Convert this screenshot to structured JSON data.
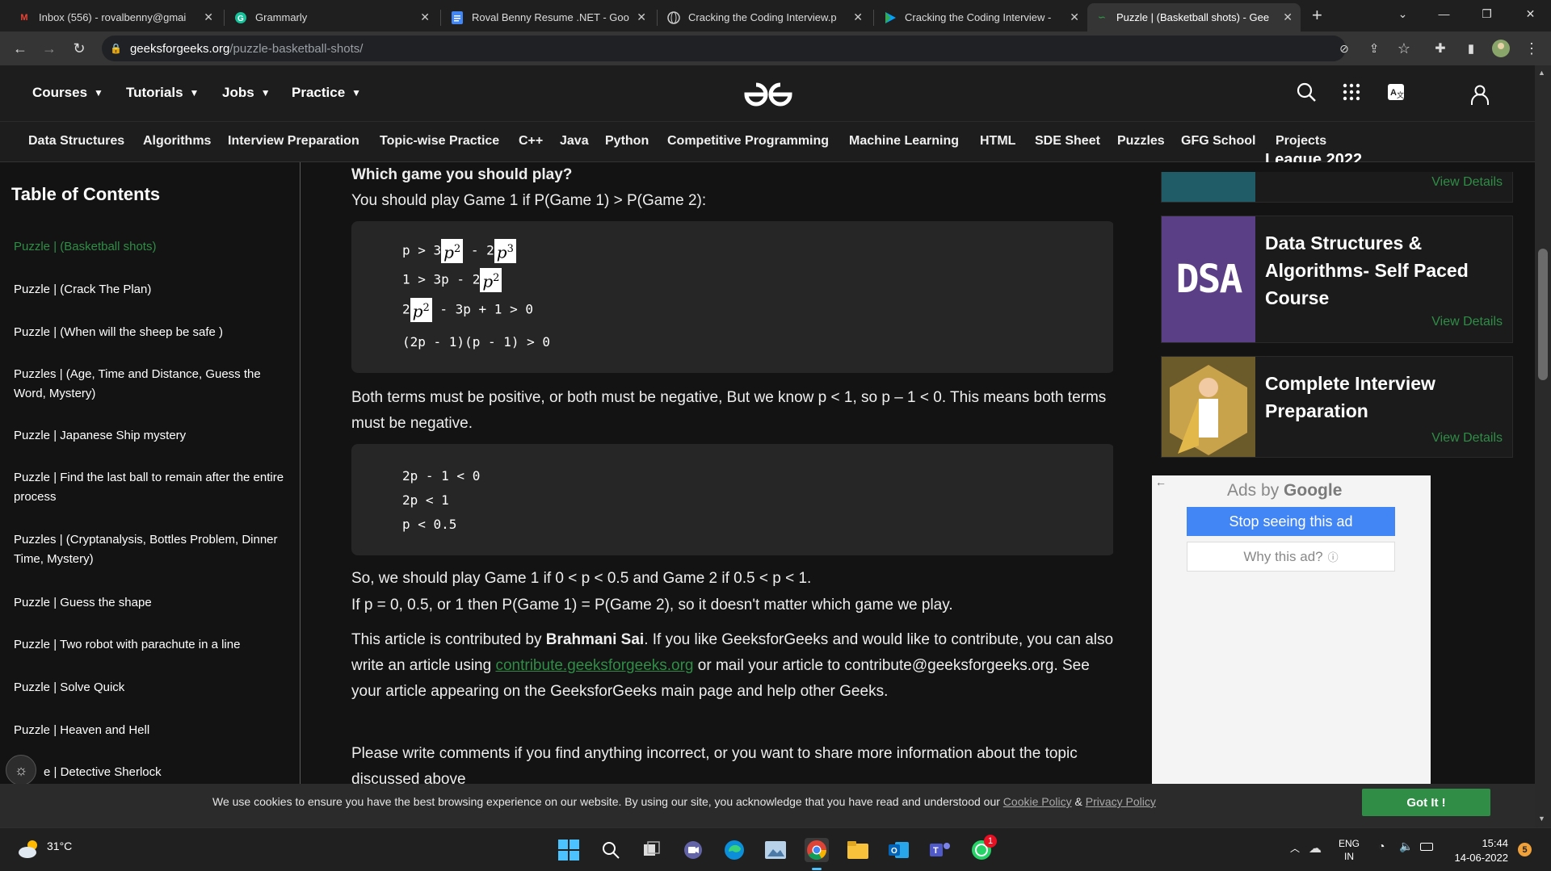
{
  "browser": {
    "tabs": [
      {
        "title": "Inbox (556) - rovalbenny@gmai",
        "icon": "gmail-icon"
      },
      {
        "title": "Grammarly",
        "icon": "grammarly-icon"
      },
      {
        "title": "Roval Benny Resume .NET - Goo",
        "icon": "docs-icon"
      },
      {
        "title": "Cracking the Coding Interview.p",
        "icon": "globe-icon"
      },
      {
        "title": "Cracking the Coding Interview -",
        "icon": "play-icon"
      },
      {
        "title": "Puzzle | (Basketball shots) - Gee",
        "icon": "gfg-icon",
        "active": true
      }
    ],
    "url_host": "geeksforgeeks.org",
    "url_path": "/puzzle-basketball-shots/"
  },
  "header": {
    "menus": [
      "Courses",
      "Tutorials",
      "Jobs",
      "Practice"
    ],
    "subnav": [
      "Data Structures",
      "Algorithms",
      "Interview Preparation",
      "Topic-wise Practice",
      "C++",
      "Java",
      "Python",
      "Competitive Programming",
      "Machine Learning",
      "HTML",
      "SDE Sheet",
      "Puzzles",
      "GFG School",
      "Projects"
    ]
  },
  "toc": {
    "title": "Table of Contents",
    "items": [
      "Puzzle | (Basketball shots)",
      "Puzzle | (Crack The Plan)",
      "Puzzle | (When will the sheep be safe )",
      "Puzzles | (Age, Time and Distance, Guess the Word, Mystery)",
      "Puzzle | Japanese Ship mystery",
      "Puzzle | Find the last ball to remain after the entire process",
      "Puzzles | (Cryptanalysis, Bottles Problem, Dinner Time, Mystery)",
      "Puzzle | Guess the shape",
      "Puzzle | Two robot with parachute in a line",
      "Puzzle | Solve Quick",
      "Puzzle | Heaven and Hell",
      "e | Detective Sherlock"
    ]
  },
  "article": {
    "heading": "Which game you should play?",
    "intro": "You should play Game 1 if P(Game 1) > P(Game 2):",
    "code1": {
      "l1_a": "p > 3",
      "l1_b": "p",
      "l1_e": "2",
      "l1_c": " - 2",
      "l1_d": "p",
      "l1_f": "3",
      "l2_a": "1 > 3p - 2",
      "l2_b": "p",
      "l2_e": "2",
      "l3_a": "2",
      "l3_b": "p",
      "l3_e": "2",
      "l3_c": " - 3p + 1 > 0",
      "l4": "(2p - 1)(p - 1) > 0"
    },
    "para2": "Both terms must be positive, or both must be negative, But we know p < 1, so p – 1 < 0. This means both terms must be negative.",
    "code2": [
      "2p - 1 < 0",
      "2p < 1",
      "p < 0.5"
    ],
    "para3a": "So, we should play Game 1 if 0 < p < 0.5 and Game 2 if 0.5 < p < 1.",
    "para3b": "If p = 0, 0.5, or 1 then P(Game 1) = P(Game 2), so it doesn't matter which game we play.",
    "contrib_1": "This article is contributed by ",
    "contrib_name": "Brahmani Sai",
    "contrib_2": ". If you like GeeksforGeeks and would like to contribute, you can also write an article using ",
    "contrib_link": "contribute.geeksforgeeks.org",
    "contrib_3": " or mail your article to contribute@geeksforgeeks.org. See your article appearing on the GeeksforGeeks main page and help other Geeks.",
    "comments": "Please write comments if you find anything incorrect, or you want to share more information about the topic discussed above"
  },
  "sidebar": {
    "cards": [
      {
        "title": "League 2022",
        "cta": "View Details"
      },
      {
        "title": "Data Structures & Algorithms- Self Paced Course",
        "img_text": "DSA",
        "cta": "View Details"
      },
      {
        "title": "Complete Interview Preparation",
        "cta": "View Details"
      }
    ],
    "ad": {
      "ads_by": "Ads by",
      "google": "Google",
      "stop": "Stop seeing this ad",
      "why": "Why this ad?"
    }
  },
  "cookie": {
    "text": "We use cookies to ensure you have the best browsing experience on our website. By using our site, you acknowledge that you have read and understood our",
    "cookie_policy": "Cookie Policy",
    "amp": "&",
    "privacy_policy": "Privacy Policy",
    "button": "Got It !"
  },
  "taskbar": {
    "weather": "31°C",
    "lang1": "ENG",
    "lang2": "IN",
    "time": "15:44",
    "date": "14-06-2022",
    "whatsapp_badge": "1",
    "notif_count": "5"
  },
  "colors": {
    "accent": "#2f8d46",
    "bg": "#131313",
    "code_bg": "#262626"
  }
}
